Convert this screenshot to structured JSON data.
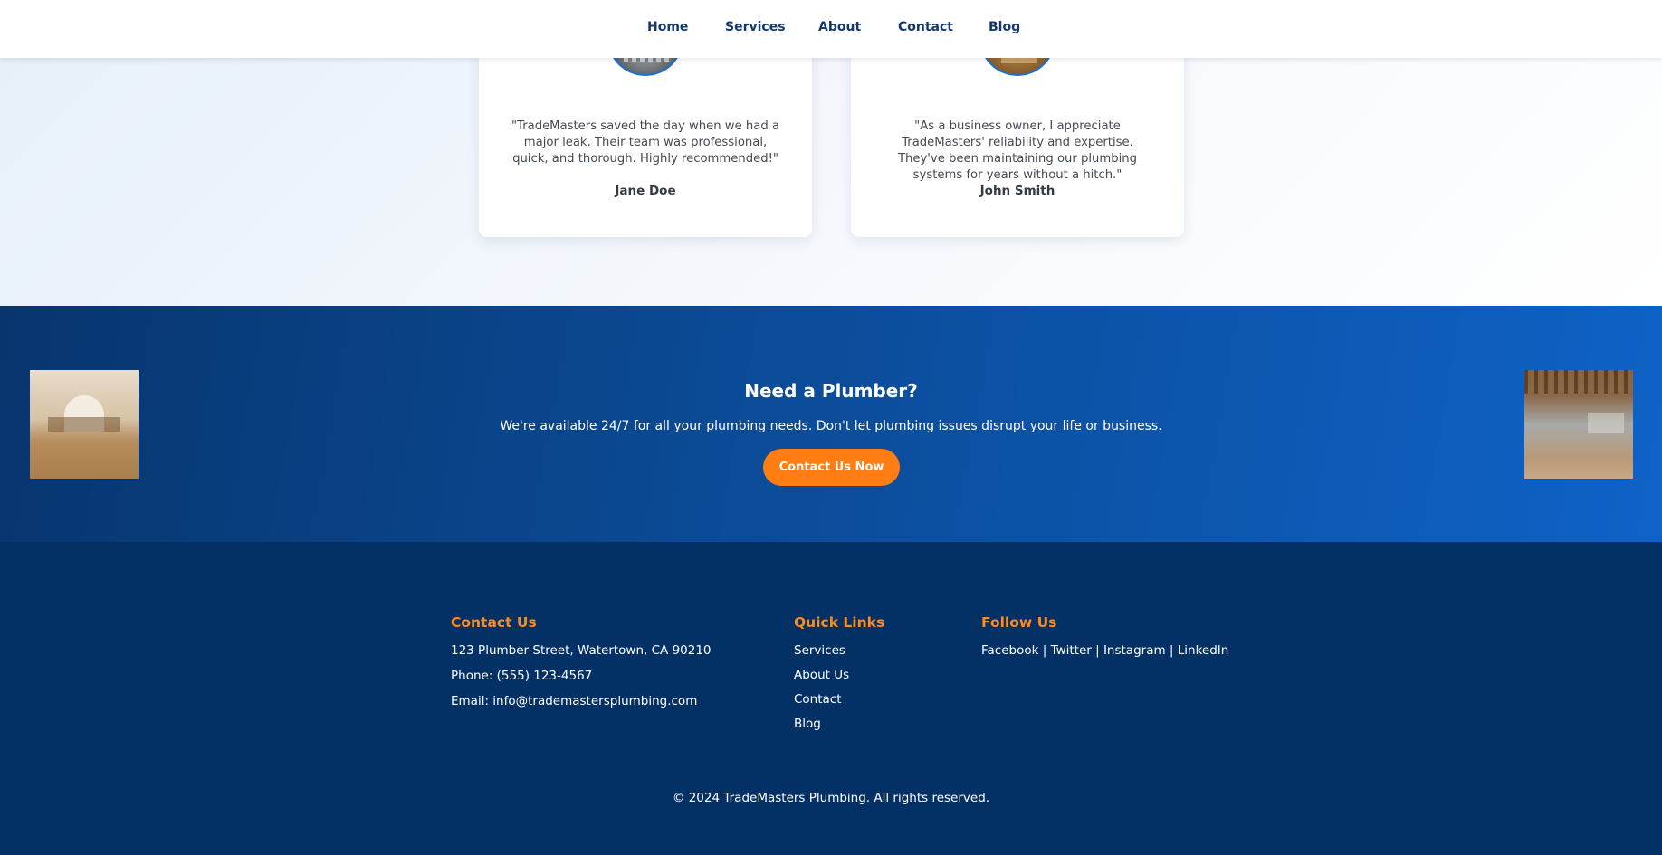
{
  "nav": {
    "items": [
      {
        "label": "Home"
      },
      {
        "label": "Services"
      },
      {
        "label": "About"
      },
      {
        "label": "Contact"
      },
      {
        "label": "Blog"
      }
    ]
  },
  "testimonials": [
    {
      "quote": "\"TradeMasters saved the day when we had a major leak. Their team was professional, quick, and thorough. Highly recommended!\"",
      "author": "Jane Doe"
    },
    {
      "quote": "\"As a business owner, I appreciate TradeMasters' reliability and expertise. They've been maintaining our plumbing systems for years without a hitch.\"",
      "author": "John Smith"
    }
  ],
  "cta": {
    "title": "Need a Plumber?",
    "text": "We're available 24/7 for all your plumbing needs. Don't let plumbing issues disrupt your life or business.",
    "button_label": "Contact Us Now"
  },
  "footer": {
    "contact": {
      "heading": "Contact Us",
      "address": "123 Plumber Street, Watertown, CA 90210",
      "phone": "Phone: (555) 123-4567",
      "email": "Email: info@trademastersplumbing.com"
    },
    "quick_links": {
      "heading": "Quick Links",
      "items": [
        {
          "label": "Services"
        },
        {
          "label": "About Us"
        },
        {
          "label": "Contact"
        },
        {
          "label": "Blog"
        }
      ]
    },
    "follow": {
      "heading": "Follow Us",
      "text": "Facebook | Twitter | Instagram | LinkedIn"
    },
    "copyright": "© 2024 TradeMasters Plumbing. All rights reserved."
  },
  "colors": {
    "nav_text": "#14386b",
    "accent_orange": "#ff7d12",
    "footer_bg": "#033166",
    "cta_bg_start": "#08356e",
    "cta_bg_end": "#0f62c7"
  }
}
